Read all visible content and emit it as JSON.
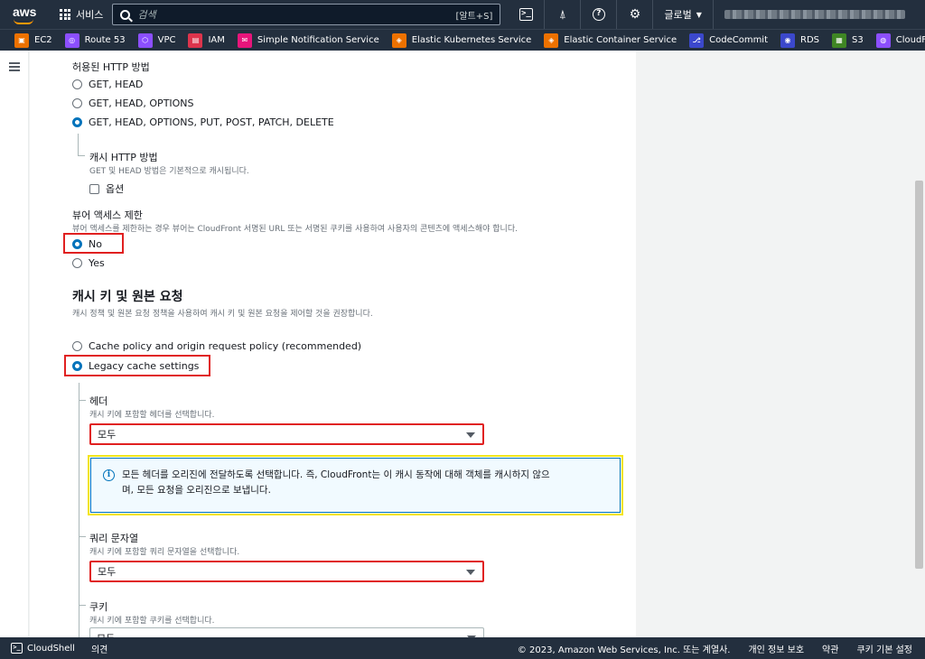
{
  "topnav": {
    "logo": "aws",
    "services_label": "서비스",
    "search_placeholder": "검색",
    "search_shortcut": "[알트+S]",
    "region_label": "글로벌"
  },
  "favorites": [
    {
      "label": "EC2",
      "color": "#ed7100",
      "icon": "ec2-icon"
    },
    {
      "label": "Route 53",
      "color": "#8c4fff",
      "icon": "route53-icon"
    },
    {
      "label": "VPC",
      "color": "#8c4fff",
      "icon": "vpc-icon"
    },
    {
      "label": "IAM",
      "color": "#dd344c",
      "icon": "iam-icon"
    },
    {
      "label": "Simple Notification Service",
      "color": "#e7157b",
      "icon": "sns-icon"
    },
    {
      "label": "Elastic Kubernetes Service",
      "color": "#ed7100",
      "icon": "eks-icon"
    },
    {
      "label": "Elastic Container Service",
      "color": "#ed7100",
      "icon": "ecs-icon"
    },
    {
      "label": "CodeCommit",
      "color": "#3b48cc",
      "icon": "codecommit-icon"
    },
    {
      "label": "RDS",
      "color": "#3b48cc",
      "icon": "rds-icon"
    },
    {
      "label": "S3",
      "color": "#3f8624",
      "icon": "s3-icon"
    },
    {
      "label": "CloudFront",
      "color": "#8c4fff",
      "icon": "cloudfront-icon"
    }
  ],
  "form": {
    "http_methods_title": "허용된 HTTP 방법",
    "http_methods": [
      "GET, HEAD",
      "GET, HEAD, OPTIONS",
      "GET, HEAD, OPTIONS, PUT, POST, PATCH, DELETE"
    ],
    "http_methods_selected": 2,
    "cache_http_title": "캐시 HTTP 방법",
    "cache_http_desc": "GET 및 HEAD 방법은 기본적으로 캐시됩니다.",
    "cache_http_option": "옵션",
    "viewer_access_title": "뷰어 액세스 제한",
    "viewer_access_desc": "뷰어 액세스를 제한하는 경우 뷰어는 CloudFront 서명된 URL 또는 서명된 쿠키를 사용하여 사용자의 콘텐츠에 액세스해야 합니다.",
    "viewer_access_options": [
      "No",
      "Yes"
    ],
    "viewer_access_selected": 0,
    "cache_key_title": "캐시 키 및 원본 요청",
    "cache_key_desc": "캐시 정책 및 원본 요청 정책을 사용하여 캐시 키 및 원본 요청을 제어할 것을 권장합니다.",
    "cache_key_options": [
      "Cache policy and origin request policy (recommended)",
      "Legacy cache settings"
    ],
    "cache_key_selected": 1,
    "headers_title": "헤더",
    "headers_desc": "캐시 키에 포함할 헤더를 선택합니다.",
    "headers_value": "모두",
    "headers_info": "모든 헤더를 오리진에 전달하도록 선택합니다. 즉, CloudFront는 이 캐시 동작에 대해 객체를 캐시하지 않으며, 모든 요청을 오리진으로 보냅니다.",
    "headers_info_line1": "모든 헤더를 오리진에 전달하도록 선택합니다. 즉, CloudFront는 이 캐시 동작에 대해 객체를 캐시하지 않으",
    "headers_info_line2": "며, 모든 요청을 오리진으로 보냅니다.",
    "query_title": "쿼리 문자열",
    "query_desc": "캐시 키에 포함할 쿼리 문자열을 선택합니다.",
    "query_value": "모두",
    "cookies_title": "쿠키",
    "cookies_desc": "캐시 키에 포함할 쿠키를 선택합니다.",
    "cookies_value": "모두"
  },
  "footer": {
    "cloudshell": "CloudShell",
    "feedback": "의견",
    "copyright": "© 2023, Amazon Web Services, Inc. 또는 계열사.",
    "privacy": "개인 정보 보호",
    "terms": "약관",
    "cookie_prefs": "쿠키 기본 설정"
  },
  "colors": {
    "nav_bg": "#232f3e",
    "accent_blue": "#0073bb",
    "highlight_red": "#e02020",
    "highlight_yellow": "#f5e51a"
  }
}
